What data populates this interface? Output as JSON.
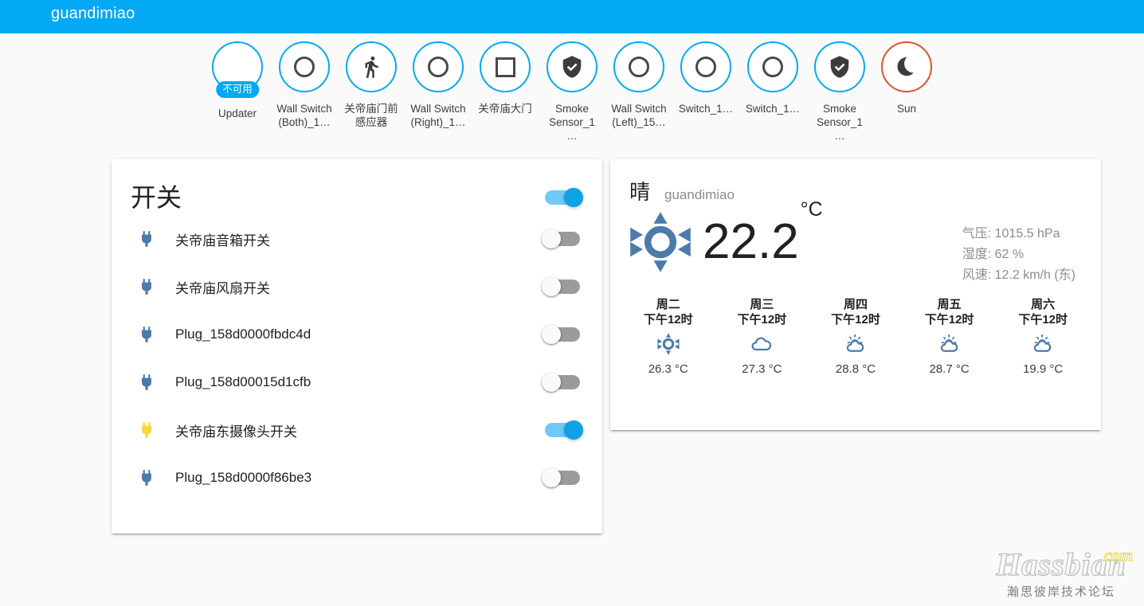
{
  "header": {
    "title": "guandimiao"
  },
  "badges": [
    {
      "label": "Updater",
      "icon": "blank-icon",
      "value": "不可用",
      "ring": "#03a9f4"
    },
    {
      "label": "Wall Switch (Both)_1…",
      "icon": "circle-outline-icon",
      "value": "",
      "ring": "#03a9f4"
    },
    {
      "label": "关帝庙门前感应器",
      "icon": "walk-icon",
      "value": "",
      "ring": "#03a9f4"
    },
    {
      "label": "Wall Switch (Right)_1…",
      "icon": "circle-outline-icon",
      "value": "",
      "ring": "#03a9f4"
    },
    {
      "label": "关帝庙大门",
      "icon": "square-outline-icon",
      "value": "",
      "ring": "#03a9f4"
    },
    {
      "label": "Smoke Sensor_1…",
      "icon": "shield-check-icon",
      "value": "",
      "ring": "#03a9f4"
    },
    {
      "label": "Wall Switch (Left)_15…",
      "icon": "circle-outline-icon",
      "value": "",
      "ring": "#03a9f4"
    },
    {
      "label": "Switch_1…",
      "icon": "circle-outline-icon",
      "value": "",
      "ring": "#03a9f4"
    },
    {
      "label": "Switch_1…",
      "icon": "circle-outline-icon",
      "value": "",
      "ring": "#03a9f4"
    },
    {
      "label": "Smoke Sensor_1…",
      "icon": "shield-check-icon",
      "value": "",
      "ring": "#03a9f4"
    },
    {
      "label": "Sun",
      "icon": "moon-icon",
      "value": "",
      "ring": "#e2502a"
    }
  ],
  "switch_card": {
    "title": "开关",
    "master_on": true,
    "rows": [
      {
        "name": "关帝庙音箱开关",
        "icon": "power-plug-icon",
        "icon_color": "#4b7bab",
        "on": false
      },
      {
        "name": "关帝庙风扇开关",
        "icon": "power-plug-icon",
        "icon_color": "#4b7bab",
        "on": false
      },
      {
        "name": "Plug_158d0000fbdc4d",
        "icon": "power-plug-icon",
        "icon_color": "#4b7bab",
        "on": false
      },
      {
        "name": "Plug_158d00015d1cfb",
        "icon": "power-plug-icon",
        "icon_color": "#4b7bab",
        "on": false
      },
      {
        "name": "关帝庙东摄像头开关",
        "icon": "power-plug-icon",
        "icon_color": "#fdd835",
        "on": true
      },
      {
        "name": "Plug_158d0000f86be3",
        "icon": "power-plug-icon",
        "icon_color": "#4b7bab",
        "on": false
      }
    ]
  },
  "weather_card": {
    "condition": "晴",
    "location": "guandimiao",
    "icon": "sunny-icon",
    "temperature": "22.2",
    "unit": "°C",
    "details": [
      "气压: 1015.5 hPa",
      "湿度: 62 %",
      "风速: 12.2 km/h (东)"
    ],
    "forecast": [
      {
        "day": "周二",
        "time": "下午12时",
        "icon": "sunny-icon",
        "temp": "26.3 °C"
      },
      {
        "day": "周三",
        "time": "下午12时",
        "icon": "cloudy-icon",
        "temp": "27.3 °C"
      },
      {
        "day": "周四",
        "time": "下午12时",
        "icon": "partly-cloudy-icon",
        "temp": "28.8 °C"
      },
      {
        "day": "周五",
        "time": "下午12时",
        "icon": "partly-cloudy-icon",
        "temp": "28.7 °C"
      },
      {
        "day": "周六",
        "time": "下午12时",
        "icon": "partly-cloudy-icon",
        "temp": "19.9 °C"
      }
    ]
  },
  "watermark": {
    "name": "Hassbian",
    "tld": "com",
    "subtitle": "瀚思彼岸技术论坛"
  },
  "colors": {
    "accent": "#03a9f4",
    "badge_ring": "#03a9f4",
    "sun_ring": "#e2502a",
    "weather_icon": "#4b7bab",
    "background": "#fafafa"
  }
}
